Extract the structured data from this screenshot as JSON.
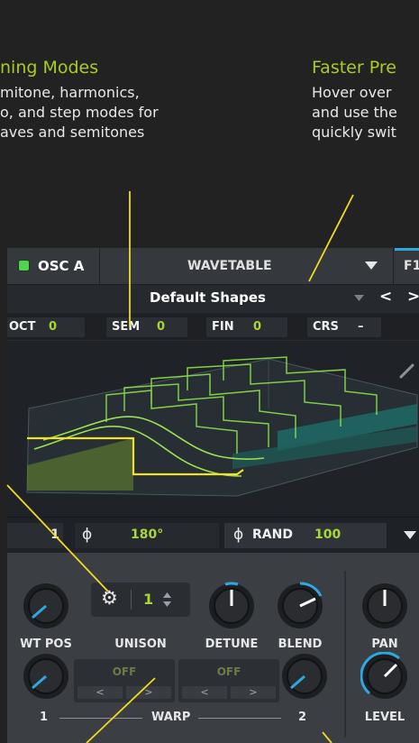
{
  "annotations": {
    "left_title": "ning Modes",
    "left_body": [
      "mitone, harmonics,",
      "o, and step modes for",
      "aves and semitones"
    ],
    "right_title": "Faster Pre",
    "right_body": [
      "Hover over",
      "and use the",
      "quickly swit"
    ]
  },
  "header": {
    "osc_name": "OSC A",
    "mode": "WAVETABLE",
    "next_tab": "F1"
  },
  "preset": {
    "name": "Default Shapes",
    "prev": "<",
    "next": ">"
  },
  "tuning": [
    {
      "label": "OCT",
      "value": "0"
    },
    {
      "label": "SEM",
      "value": "0"
    },
    {
      "label": "FIN",
      "value": "0"
    },
    {
      "label": "CRS",
      "value": "–"
    }
  ],
  "phase": {
    "voice_value": "1",
    "phase_symbol": "ϕ",
    "phase_value": "180°",
    "rand_label": "RAND",
    "rand_value": "100"
  },
  "unison": {
    "label": "UNISON",
    "voices": "1"
  },
  "knobs": {
    "wt_pos": "WT POS",
    "detune": "DETUNE",
    "blend": "BLEND",
    "pan": "PAN",
    "level": "LEVEL"
  },
  "warp": {
    "label": "WARP",
    "slot1_value": "OFF",
    "slot2_value": "OFF",
    "knob1": "1",
    "knob2": "2",
    "left_arrow": "<",
    "right_arrow": ">"
  },
  "colors": {
    "accent_green": "#a8d834",
    "annotation_yellow": "#f0dc1e",
    "knob_indicator": "#2ea8e0"
  }
}
